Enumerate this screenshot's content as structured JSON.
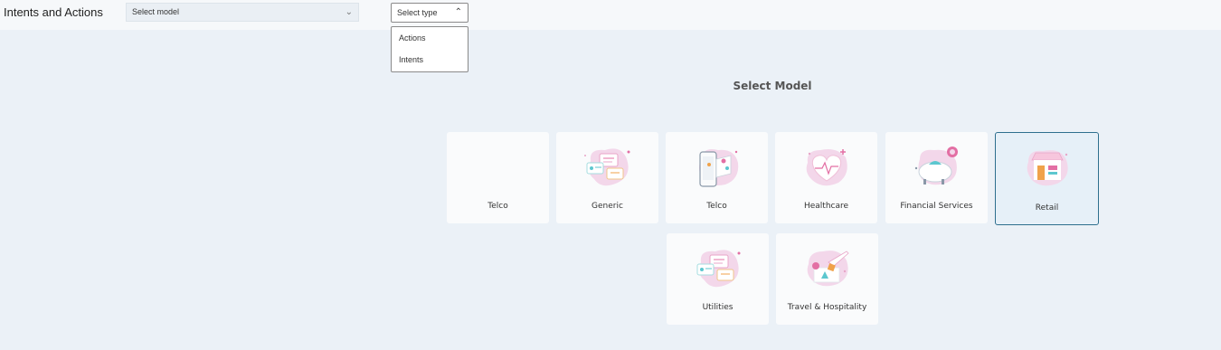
{
  "header": {
    "title": "Intents and Actions",
    "model_select": {
      "value": "Select model"
    },
    "type_select": {
      "value": "Select type"
    }
  },
  "type_dropdown": {
    "options": [
      "Actions",
      "Intents"
    ]
  },
  "main": {
    "section_title": "Select Model",
    "cards": [
      {
        "label": "Telco",
        "icon": "none",
        "selected": false
      },
      {
        "label": "Generic",
        "icon": "document-cards-icon",
        "selected": false
      },
      {
        "label": "Telco",
        "icon": "phone-map-icon",
        "selected": false
      },
      {
        "label": "Healthcare",
        "icon": "heart-pulse-icon",
        "selected": false
      },
      {
        "label": "Financial Services",
        "icon": "piggy-bank-icon",
        "selected": false
      },
      {
        "label": "Retail",
        "icon": "storefront-icon",
        "selected": true
      },
      {
        "label": "Utilities",
        "icon": "document-cards-icon",
        "selected": false
      },
      {
        "label": "Travel & Hospitality",
        "icon": "airplane-shapes-icon",
        "selected": false
      }
    ]
  },
  "colors": {
    "page_bg": "#ebf1f7",
    "header_bg": "#f6f8fa",
    "card_bg": "#fafbfc",
    "selected_border": "#2e6f8e",
    "selected_bg": "#e6f0f8",
    "illustration_pink": "#f3d7ea"
  }
}
